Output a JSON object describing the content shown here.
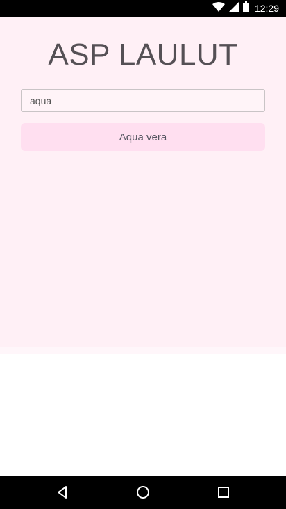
{
  "status_bar": {
    "time": "12:29",
    "icons": [
      "wifi-icon",
      "signal-icon",
      "battery-icon"
    ]
  },
  "app": {
    "title": "ASP LAULUT",
    "search": {
      "value": "aqua",
      "placeholder": ""
    },
    "results": [
      {
        "label": "Aqua vera"
      }
    ]
  },
  "nav_bar": {
    "buttons": [
      "back-icon",
      "home-icon",
      "recents-icon"
    ]
  },
  "colors": {
    "app_background": "#fff0f6",
    "result_button": "#ffdff0",
    "title_text": "#555055",
    "system_bars": "#000000"
  }
}
